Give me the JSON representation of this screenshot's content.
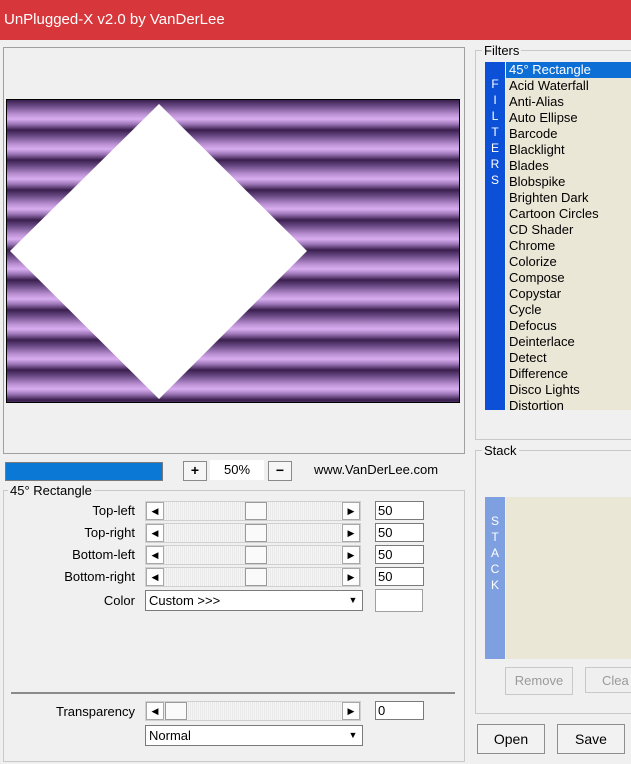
{
  "window": {
    "title": "UnPlugged-X v2.0 by VanDerLee"
  },
  "preview_toolbar": {
    "zoom_in_label": "+",
    "zoom_level": "50%",
    "zoom_out_label": "−",
    "website": "www.VanDerLee.com"
  },
  "settings": {
    "group_title": "45° Rectangle",
    "rows": [
      {
        "label": "Top-left",
        "value": "50"
      },
      {
        "label": "Top-right",
        "value": "50"
      },
      {
        "label": "Bottom-left",
        "value": "50"
      },
      {
        "label": "Bottom-right",
        "value": "50"
      }
    ],
    "color": {
      "label": "Color",
      "selected": "Custom >>>",
      "swatch": "#ffffff"
    },
    "transparency": {
      "label": "Transparency",
      "value": "0"
    },
    "blend_mode": "Normal"
  },
  "filters": {
    "group_title": "Filters",
    "sidebar_letters": "F I L T E R S",
    "items": [
      "45° Rectangle",
      "Acid Waterfall",
      "Anti-Alias",
      "Auto Ellipse",
      "Barcode",
      "Blacklight",
      "Blades",
      "Blobspike",
      "Brighten Dark",
      "Cartoon Circles",
      "CD Shader",
      "Chrome",
      "Colorize",
      "Compose",
      "Copystar",
      "Cycle",
      "Defocus",
      "Deinterlace",
      "Detect",
      "Difference",
      "Disco Lights",
      "Distortion"
    ],
    "selected_index": 0
  },
  "stack": {
    "group_title": "Stack",
    "sidebar_letters": "S T A C K",
    "remove_label": "Remove",
    "clear_label": "Clea"
  },
  "buttons": {
    "open": "Open",
    "save": "Save"
  },
  "colors": {
    "title_bar": "#d7363a",
    "accent": "#0d50d8",
    "list_bg": "#ebe7d6"
  }
}
